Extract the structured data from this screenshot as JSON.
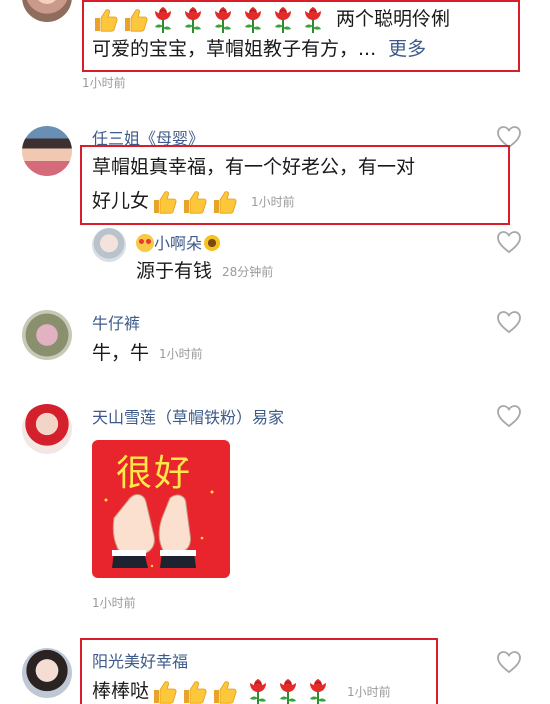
{
  "comments": [
    {
      "text": "两个聪明伶俐",
      "text2": "可爱的宝宝，草帽姐教子有方，...",
      "more": "更多",
      "time": "1小时前"
    },
    {
      "name": "任三姐《母婴》",
      "line1": "草帽姐真幸福，有一个好老公，有一对",
      "line2": "好儿女",
      "time": "1小时前"
    },
    {
      "name": "小啊朵",
      "text": "源于有钱",
      "time": "28分钟前"
    },
    {
      "name": "牛仔裤",
      "text": "牛，牛",
      "time": "1小时前"
    },
    {
      "name": "天山雪莲（草帽铁粉）易家",
      "sticker_text": "很好",
      "time": "1小时前"
    },
    {
      "name": "阳光美好幸福",
      "text": "棒棒哒",
      "time": "1小时前"
    }
  ],
  "colors": {
    "highlight_box": "#d81e2a",
    "username": "#3d5a8a",
    "time": "#9a9a9a",
    "sticker_bg": "#e8242c",
    "sticker_text": "#ffe94a"
  },
  "icons": [
    "thumbs-up-emoji",
    "rose-emoji",
    "heart-outline-icon",
    "sunflower-emoji",
    "heart-eyes-emoji"
  ]
}
